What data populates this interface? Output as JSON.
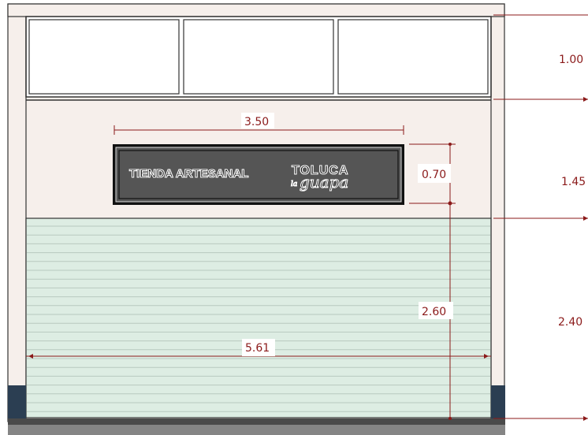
{
  "sign": {
    "text_left": "TIENDA ARTESANAL",
    "brand_top": "TOLUCA",
    "brand_small": "la",
    "brand_script": "guapa"
  },
  "dimensions": {
    "transom_height": "1.00",
    "sign_band_height": "1.45",
    "shutter_height": "2.40",
    "sign_width": "3.50",
    "sign_height": "0.70",
    "sign_bottom_to_floor": "2.60",
    "opening_width": "5.61"
  },
  "colors": {
    "wall": "#f6efeb",
    "shutter": "#ddede3",
    "sign_panel": "#555555",
    "base": "#2b3e52",
    "floor": "#858585",
    "dimension": "#8b1a1a"
  }
}
